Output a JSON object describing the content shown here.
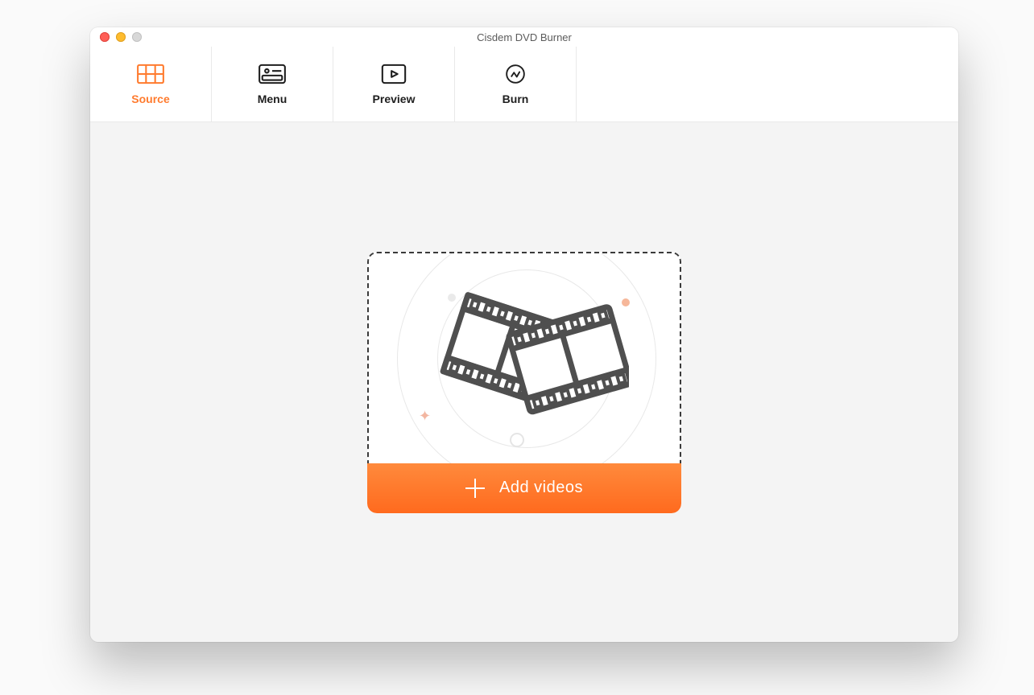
{
  "window": {
    "title": "Cisdem DVD Burner"
  },
  "tabs": [
    {
      "id": "source",
      "label": "Source",
      "active": true
    },
    {
      "id": "menu",
      "label": "Menu",
      "active": false
    },
    {
      "id": "preview",
      "label": "Preview",
      "active": false
    },
    {
      "id": "burn",
      "label": "Burn",
      "active": false
    }
  ],
  "drop": {
    "button_label": "Add videos",
    "illustration": "film-strips-icon"
  },
  "colors": {
    "accent": "#ff7b2e"
  }
}
